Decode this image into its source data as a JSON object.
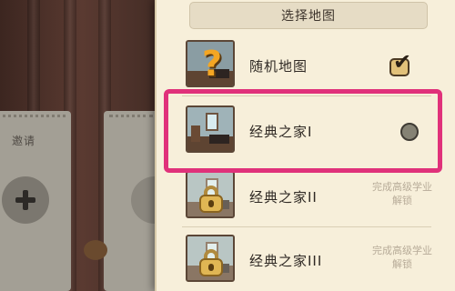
{
  "invite_card": {
    "label": "邀请"
  },
  "map_panel": {
    "title": "选择地图",
    "maps": [
      {
        "name": "随机地图",
        "state": "selected",
        "icon": "question-mark-icon",
        "mark": "?"
      },
      {
        "name": "经典之家I",
        "state": "available",
        "icon": "room-thumbnail"
      },
      {
        "name": "经典之家II",
        "state": "locked",
        "icon": "lock-icon",
        "unlock_note": "完成高级学业解锁"
      },
      {
        "name": "经典之家III",
        "state": "locked",
        "icon": "lock-icon",
        "unlock_note": "完成高级学业解锁"
      }
    ],
    "highlighted_map": "经典之家I"
  },
  "colors": {
    "panel_bg": "#f7efda",
    "highlight": "#e0317a",
    "lock_gold": "#e0b654",
    "question_mark": "#f4a623"
  }
}
